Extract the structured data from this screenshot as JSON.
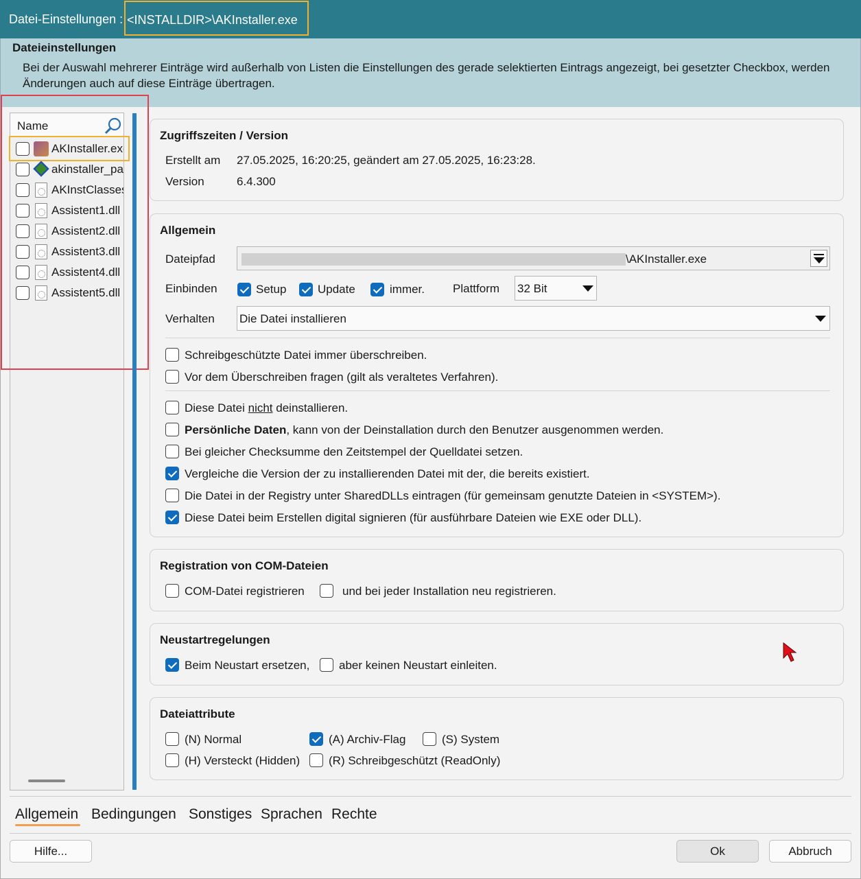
{
  "window": {
    "title_prefix": "Datei-Einstellungen :",
    "title_path": "<INSTALLDIR>\\AKInstaller.exe"
  },
  "header": {
    "title": "Dateieinstellungen",
    "description": "Bei der Auswahl mehrerer Einträge wird außerhalb von Listen die Einstellungen des gerade selektierten Eintrags angezeigt, bei gesetzter Checkbox, werden Änderungen auch auf diese Einträge übertragen."
  },
  "filelist": {
    "column_header": "Name",
    "items": [
      {
        "name": "AKInstaller.exe",
        "checked": false,
        "icon": "installer-icon"
      },
      {
        "name": "akinstaller_pac",
        "checked": false,
        "icon": "package-icon"
      },
      {
        "name": "AKInstClasses.",
        "checked": false,
        "icon": "dll-file-icon"
      },
      {
        "name": "Assistent1.dll",
        "checked": false,
        "icon": "dll-file-icon"
      },
      {
        "name": "Assistent2.dll",
        "checked": false,
        "icon": "dll-file-icon"
      },
      {
        "name": "Assistent3.dll",
        "checked": false,
        "icon": "dll-file-icon"
      },
      {
        "name": "Assistent4.dll",
        "checked": false,
        "icon": "dll-file-icon"
      },
      {
        "name": "Assistent5.dll",
        "checked": false,
        "icon": "dll-file-icon"
      }
    ]
  },
  "access": {
    "title": "Zugriffszeiten / Version",
    "created_label": "Erstellt am",
    "created_value": "27.05.2025, 16:20:25,  geändert am 27.05.2025, 16:23:28.",
    "version_label": "Version",
    "version_value": "6.4.300"
  },
  "general": {
    "title": "Allgemein",
    "path_label": "Dateipfad",
    "path_value": "\\AKInstaller.exe",
    "include_label": "Einbinden",
    "setup": "Setup",
    "update": "Update",
    "always": "immer.",
    "platform_label": "Plattform",
    "platform_value": "32 Bit",
    "behavior_label": "Verhalten",
    "behavior_value": "Die Datei installieren",
    "options": [
      {
        "text": "Schreibgeschützte Datei immer überschreiben.",
        "checked": false
      },
      {
        "text": "Vor dem Überschreiben fragen (gilt als veraltetes Verfahren).",
        "checked": false
      },
      {
        "text_a": "Diese Datei ",
        "text_u": "nicht",
        "text_b": " deinstallieren.",
        "checked": false
      },
      {
        "text_bold": "Persönliche Daten",
        "text_b": ", kann von der Deinstallation durch den Benutzer ausgenommen werden.",
        "checked": false
      },
      {
        "text": "Bei gleicher Checksumme den Zeitstempel der Quelldatei setzen.",
        "checked": false
      },
      {
        "text": "Vergleiche die Version der zu installierenden Datei mit der, die bereits existiert.",
        "checked": true
      },
      {
        "text": "Die Datei in der Registry unter SharedDLLs eintragen (für gemeinsam genutzte Dateien in <SYSTEM>).",
        "checked": false
      },
      {
        "text": "Diese Datei beim Erstellen digital signieren (für ausführbare Dateien wie EXE oder DLL).",
        "checked": true
      }
    ]
  },
  "com": {
    "title": "Registration von COM-Dateien",
    "register": "COM-Datei registrieren",
    "reregister": "und bei jeder Installation neu registrieren."
  },
  "restart": {
    "title": "Neustartregelungen",
    "replace": "Beim Neustart ersetzen,",
    "no_restart": "aber keinen Neustart einleiten."
  },
  "attributes": {
    "title": "Dateiattribute",
    "normal": "(N) Normal",
    "archive": "(A) Archiv-Flag",
    "system": "(S) System",
    "hidden": "(H) Versteckt (Hidden)",
    "readonly": "(R) Schreibgeschützt (ReadOnly)"
  },
  "tabs": [
    "Allgemein",
    "Bedingungen",
    "Sonstiges",
    "Sprachen",
    "Rechte"
  ],
  "buttons": {
    "help": "Hilfe...",
    "ok": "Ok",
    "cancel": "Abbruch"
  },
  "colors": {
    "titlebar": "#2a7c8c",
    "header": "#b5d3d9",
    "accent": "#0f6cbd",
    "highlight": "#f0b030",
    "annotation": "#e04050"
  }
}
